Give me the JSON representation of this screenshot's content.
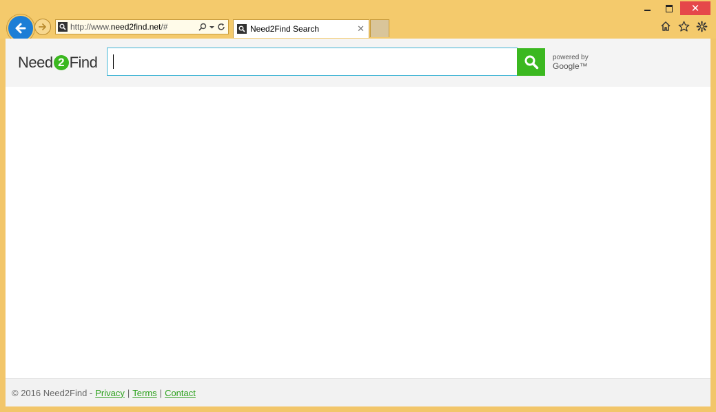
{
  "browser": {
    "window_controls": {
      "minimize": "",
      "maximize": "",
      "close": "✕"
    },
    "address": {
      "prefix": "http://www.",
      "host": "need2find.net",
      "suffix": "/#"
    },
    "tab": {
      "title": "Need2Find Search",
      "close": "✕"
    },
    "icons": [
      "back-arrow-icon",
      "forward-arrow-icon",
      "search-icon",
      "refresh-icon",
      "home-icon",
      "star-icon",
      "gear-icon"
    ]
  },
  "header": {
    "logo_before": "Need",
    "logo_number": "2",
    "logo_after": "Find",
    "search_value": "",
    "powered_by": "powered by",
    "google": "Google™"
  },
  "footer": {
    "copyright": "© 2016 Need2Find -",
    "links": [
      "Privacy",
      "Terms",
      "Contact"
    ],
    "separator": "|"
  },
  "colors": {
    "chrome": "#f4ca6c",
    "accent_green": "#3bb820",
    "link_green": "#2aa01a",
    "back_button_blue": "#1c7ed6",
    "close_red": "#e5474a",
    "input_border": "#3db3d4"
  }
}
